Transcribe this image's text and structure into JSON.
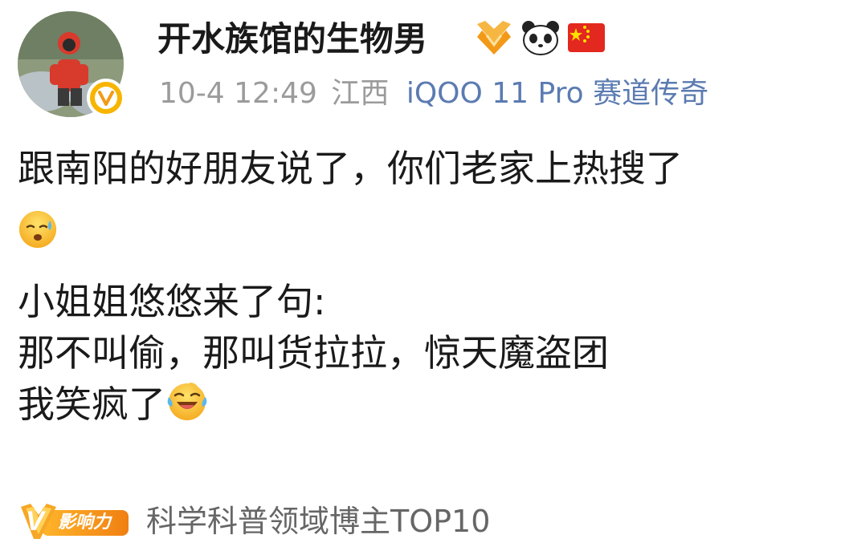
{
  "user": {
    "name": "开水族馆的生物男",
    "avatar_icon": "avatar-person-in-red-jacket",
    "verified_icon": "verified-v-icon",
    "badges": [
      "medal-badge-icon",
      "panda-emoji-icon",
      "china-flag-icon"
    ]
  },
  "meta": {
    "time": "10-4 12:49",
    "location": "江西",
    "device": "iQOO 11 Pro 赛道传奇"
  },
  "content": {
    "line1": "跟南阳的好朋友说了，你们老家上热搜了",
    "line3": "小姐姐悠悠来了句:",
    "line4": "那不叫偷，那叫货拉拉，惊天魔盗团",
    "line5": "我笑疯了",
    "emoji1": "sweat-smile-emoji-icon",
    "emoji2": "laughing-tears-emoji-icon"
  },
  "footer": {
    "badge_label": "影响力",
    "badge_letter": "V",
    "text": "科学科普领域博主TOP10"
  },
  "colors": {
    "meta_gray": "#9b9b9b",
    "device_blue": "#5b7bb1",
    "badge_orange": "#f29a18",
    "verified_yellow": "#f7b500"
  }
}
